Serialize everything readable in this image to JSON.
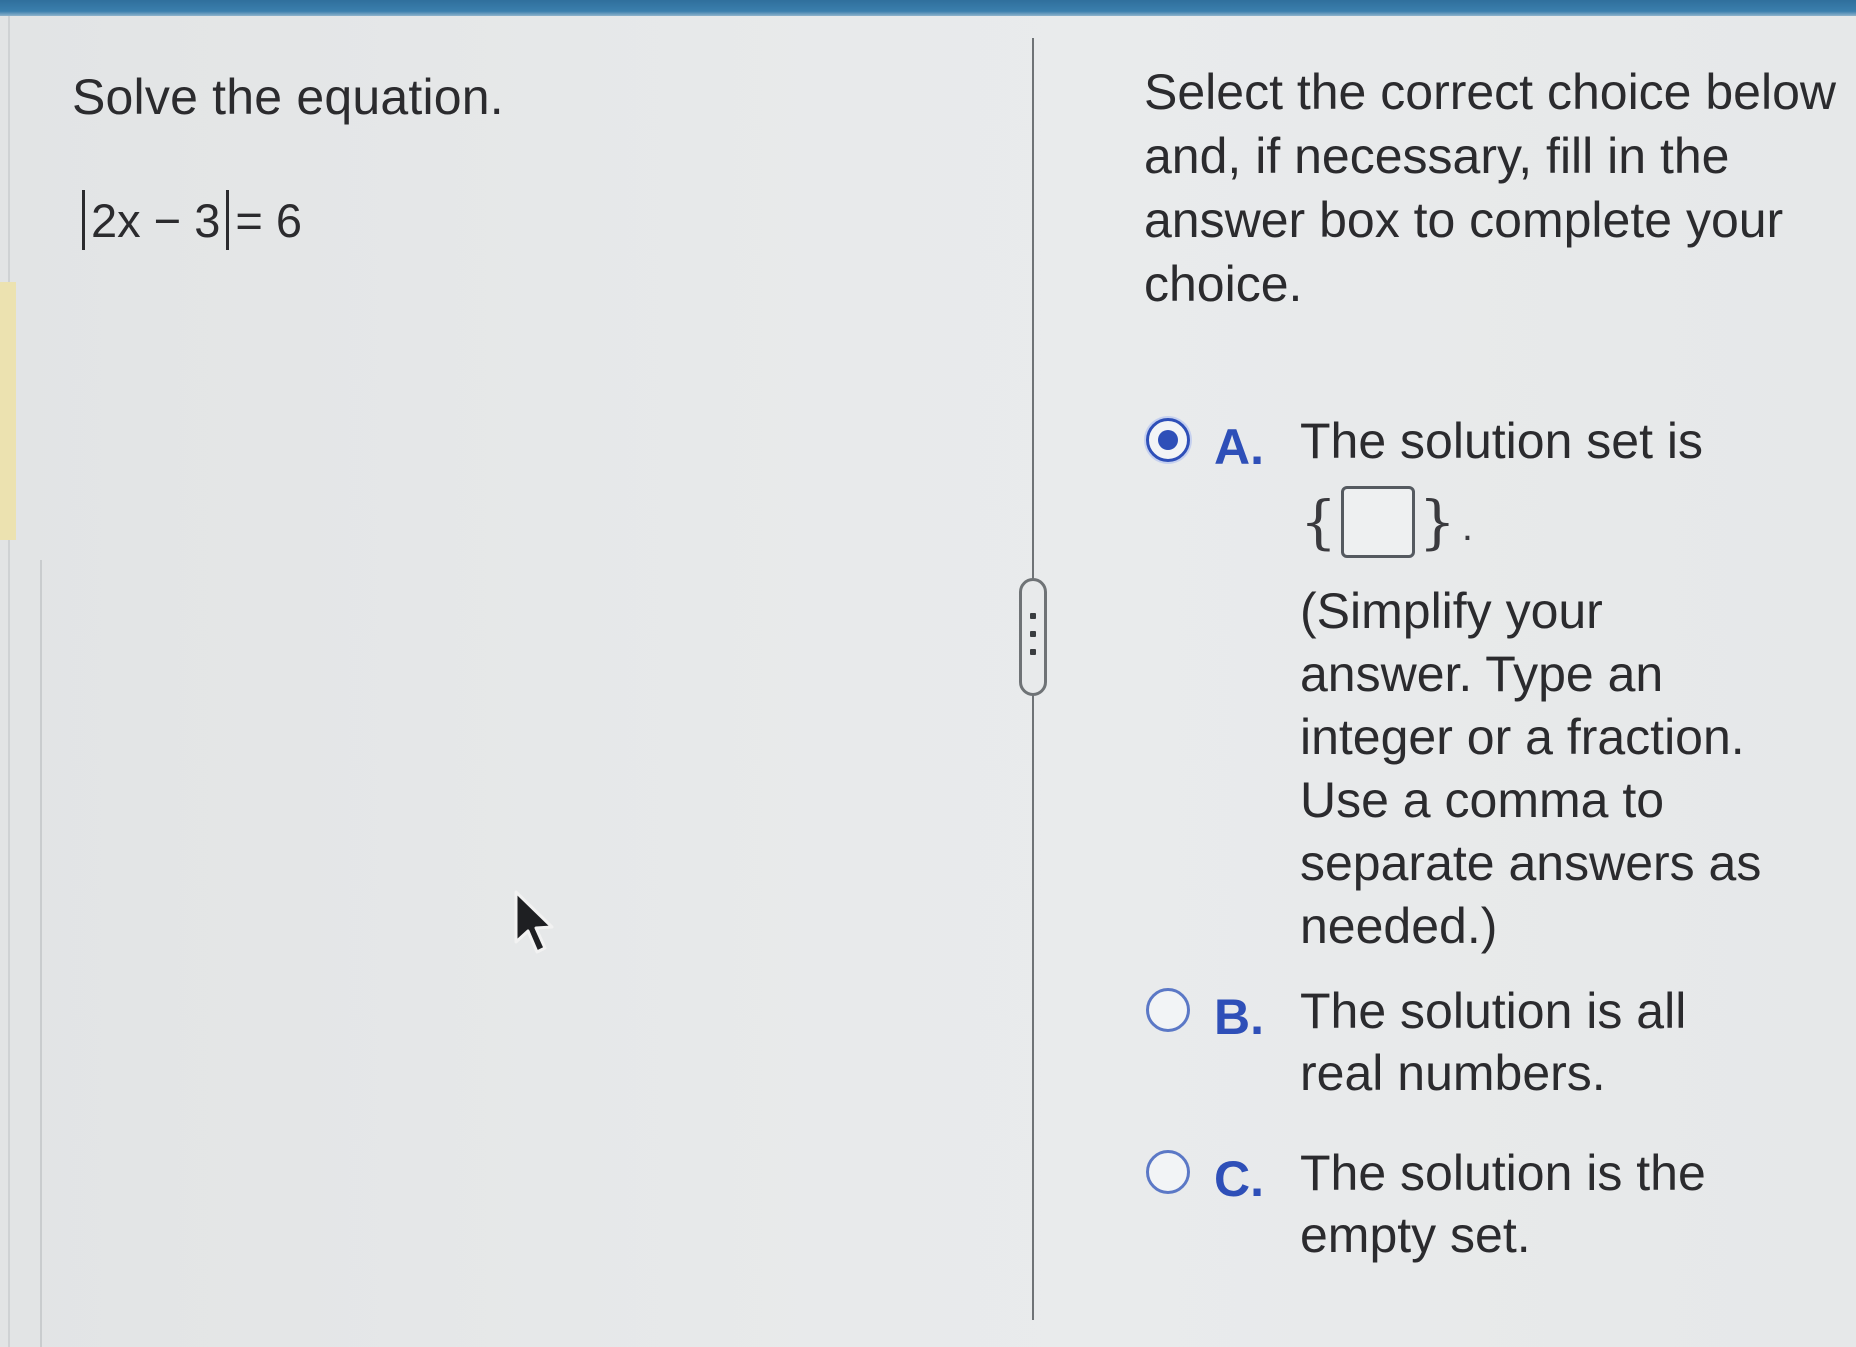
{
  "question": {
    "title": "Solve the equation.",
    "equation": {
      "inner": "2x − 3",
      "rhs": "= 6"
    }
  },
  "instructions": "Select the correct choice below and, if necessary, fill in the answer box to complete your choice.",
  "choices": [
    {
      "letter": "A.",
      "text": "The solution set is",
      "answer_value": "",
      "hint": "(Simplify your answer. Type an integer or a fraction. Use a comma to separate answers as needed.)",
      "selected": true
    },
    {
      "letter": "B.",
      "text": "The solution is all real numbers.",
      "selected": false
    },
    {
      "letter": "C.",
      "text": "The solution is the empty set.",
      "selected": false
    }
  ],
  "set_notation": {
    "open": "{",
    "close": "}",
    "period": "."
  },
  "colors": {
    "accent": "#2e4fb8",
    "radio_border": "#5b78c6",
    "top_bar": "#3b7fad",
    "text": "#2b2b2e"
  },
  "icons": [
    "radio-selected-icon",
    "radio-empty-icon",
    "mouse-pointer-icon",
    "drag-handle-icon"
  ]
}
